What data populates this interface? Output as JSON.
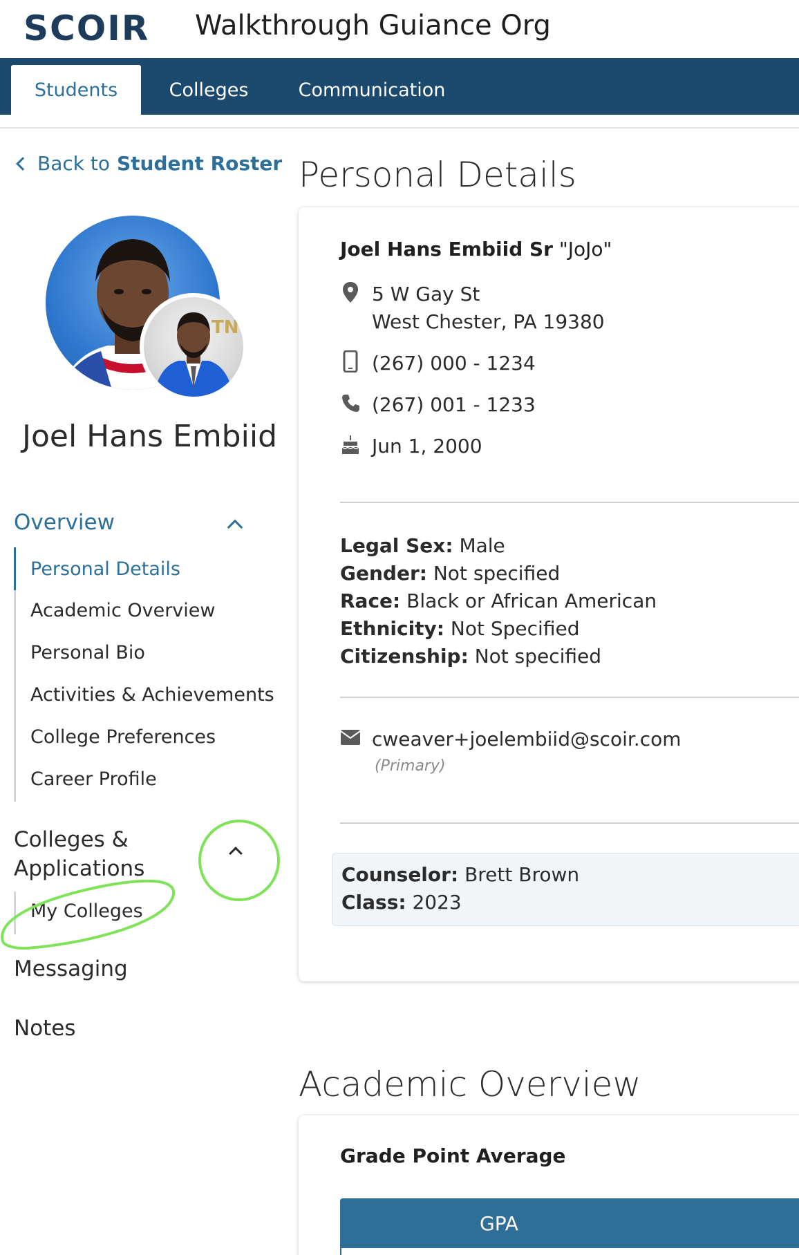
{
  "header": {
    "logo_text": "SCOIR",
    "org_title": "Walkthrough Guiance Org"
  },
  "nav": {
    "tabs": [
      {
        "label": "Students",
        "active": true
      },
      {
        "label": "Colleges",
        "active": false
      },
      {
        "label": "Communication",
        "active": false
      }
    ]
  },
  "sidebar": {
    "back_prefix": "Back to",
    "back_target": "Student Roster",
    "student_name": "Joel Hans Embiid",
    "overview": {
      "title": "Overview",
      "items": [
        {
          "label": "Personal Details",
          "active": true
        },
        {
          "label": "Academic Overview",
          "active": false
        },
        {
          "label": "Personal Bio",
          "active": false
        },
        {
          "label": "Activities & Achievements",
          "active": false
        },
        {
          "label": "College Preferences",
          "active": false
        },
        {
          "label": "Career Profile",
          "active": false
        }
      ]
    },
    "colleges": {
      "title": "Colleges & Applications",
      "items": [
        {
          "label": "My Colleges"
        }
      ]
    },
    "messaging": "Messaging",
    "notes": "Notes"
  },
  "personal_details": {
    "heading": "Personal Details",
    "name_bold": "Joel Hans Embiid Sr",
    "nickname": "\"JoJo\"",
    "address_line1": "5 W Gay St",
    "address_line2": "West Chester, PA 19380",
    "mobile": "(267) 000 - 1234",
    "phone": "(267) 001 - 1233",
    "birthday": "Jun 1, 2000",
    "demographics": [
      {
        "key": "Legal Sex:",
        "value": "Male"
      },
      {
        "key": "Gender:",
        "value": "Not specified"
      },
      {
        "key": "Race:",
        "value": "Black or African American"
      },
      {
        "key": "Ethnicity:",
        "value": "Not Specified"
      },
      {
        "key": "Citizenship:",
        "value": "Not specified"
      }
    ],
    "email": "cweaver+joelembiid@scoir.com",
    "email_note": "(Primary)",
    "counselor_key": "Counselor:",
    "counselor_value": "Brett Brown",
    "class_key": "Class:",
    "class_value": "2023"
  },
  "academic_overview": {
    "heading": "Academic Overview",
    "gpa_heading": "Grade Point Average",
    "gpa_column": "GPA"
  },
  "icons": {
    "location": "location-pin-icon",
    "mobile": "mobile-phone-icon",
    "phone": "phone-icon",
    "birthday": "birthday-cake-icon",
    "email": "envelope-icon",
    "back": "chevron-left-icon",
    "collapse": "chevron-up-icon"
  },
  "colors": {
    "brand_navy": "#1c4a6e",
    "accent_blue": "#2b6f9a",
    "annotation_green": "#7fe35a"
  }
}
